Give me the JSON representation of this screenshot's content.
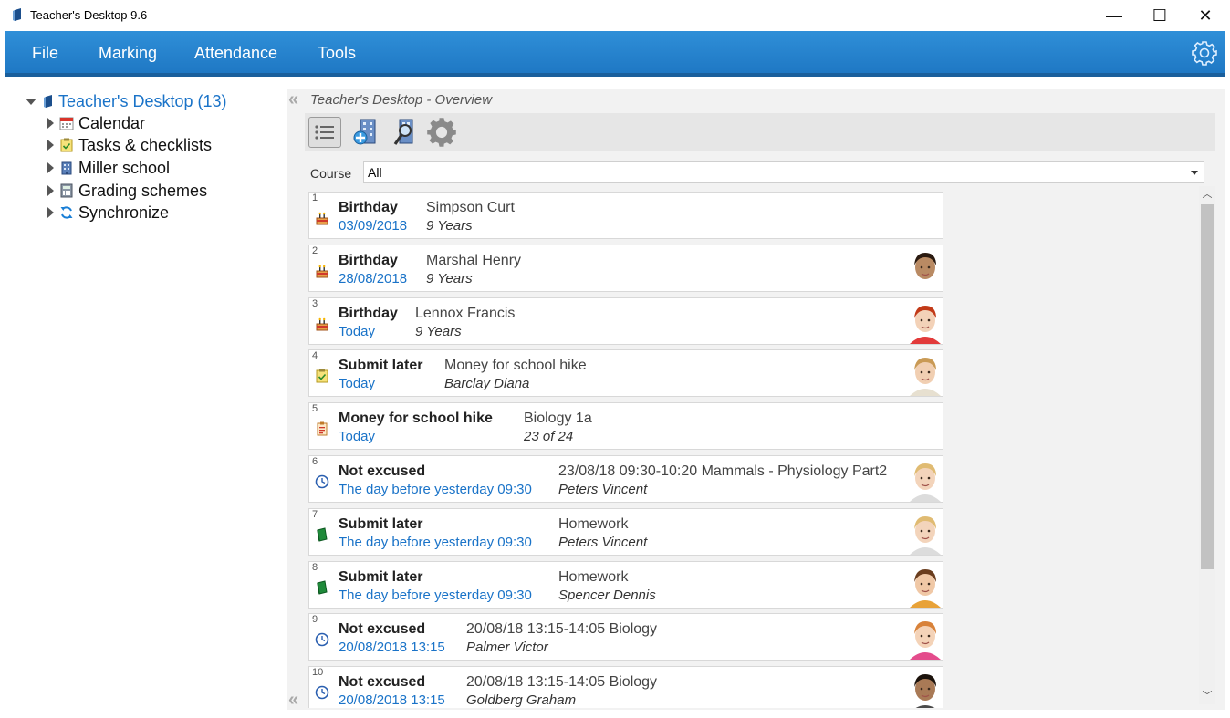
{
  "window": {
    "title": "Teacher's Desktop 9.6",
    "minimize": "—",
    "maximize": "☐",
    "close": "✕"
  },
  "menu": {
    "file": "File",
    "marking": "Marking",
    "attendance": "Attendance",
    "tools": "Tools",
    "accent": "#2584cf"
  },
  "tree": {
    "root": "Teacher's Desktop (13)",
    "items": [
      {
        "label": "Calendar",
        "icon": "calendar-icon"
      },
      {
        "label": "Tasks & checklists",
        "icon": "checklist-icon"
      },
      {
        "label": "Miller school",
        "icon": "school-building-icon"
      },
      {
        "label": "Grading schemes",
        "icon": "calculator-icon"
      },
      {
        "label": "Synchronize",
        "icon": "sync-icon"
      }
    ]
  },
  "overview": {
    "breadcrumb": "Teacher's Desktop - Overview",
    "course_label": "Course",
    "course_value": "All"
  },
  "entries": [
    {
      "num": "1",
      "icon": "birthday-cake-icon",
      "kind": "Birthday",
      "when": "03/09/2018",
      "subject": "Simpson Curt",
      "detail": "9 Years",
      "photo": "none"
    },
    {
      "num": "2",
      "icon": "birthday-cake-icon",
      "kind": "Birthday",
      "when": "28/08/2018",
      "subject": "Marshal Henry",
      "detail": "9 Years",
      "photo": "boy-dark"
    },
    {
      "num": "3",
      "icon": "birthday-cake-icon",
      "kind": "Birthday",
      "when": "Today",
      "subject": "Lennox Francis",
      "detail": "9 Years",
      "photo": "girl-red"
    },
    {
      "num": "4",
      "icon": "checklist-icon",
      "kind": "Submit later",
      "when": "Today",
      "subject": "Money for school hike",
      "detail": "Barclay Diana",
      "photo": "girl-blonde"
    },
    {
      "num": "5",
      "icon": "task-list-icon",
      "kind": "Money for school hike",
      "when": "Today",
      "subject": "Biology 1a",
      "detail": "23 of 24",
      "photo": "none"
    },
    {
      "num": "6",
      "icon": "clock-icon",
      "kind": "Not excused",
      "when": "The day before yesterday 09:30",
      "subject": "23/08/18 09:30-10:20 Mammals - Physiology Part2",
      "detail": "Peters Vincent",
      "photo": "boy-blonde"
    },
    {
      "num": "7",
      "icon": "green-book-icon",
      "kind": "Submit later",
      "when": "The day before yesterday 09:30",
      "subject": "Homework",
      "detail": "Peters Vincent",
      "photo": "boy-blonde"
    },
    {
      "num": "8",
      "icon": "green-book-icon",
      "kind": "Submit later",
      "when": "The day before yesterday 09:30",
      "subject": "Homework",
      "detail": "Spencer Dennis",
      "photo": "boy-brown"
    },
    {
      "num": "9",
      "icon": "clock-icon",
      "kind": "Not excused",
      "when": "20/08/2018 13:15",
      "subject": "20/08/18 13:15-14:05 Biology",
      "detail": "Palmer Victor",
      "photo": "girl-flower"
    },
    {
      "num": "10",
      "icon": "clock-icon",
      "kind": "Not excused",
      "when": "20/08/2018 13:15",
      "subject": "20/08/18 13:15-14:05 Biology",
      "detail": "Goldberg Graham",
      "photo": "boy-dark2"
    }
  ]
}
